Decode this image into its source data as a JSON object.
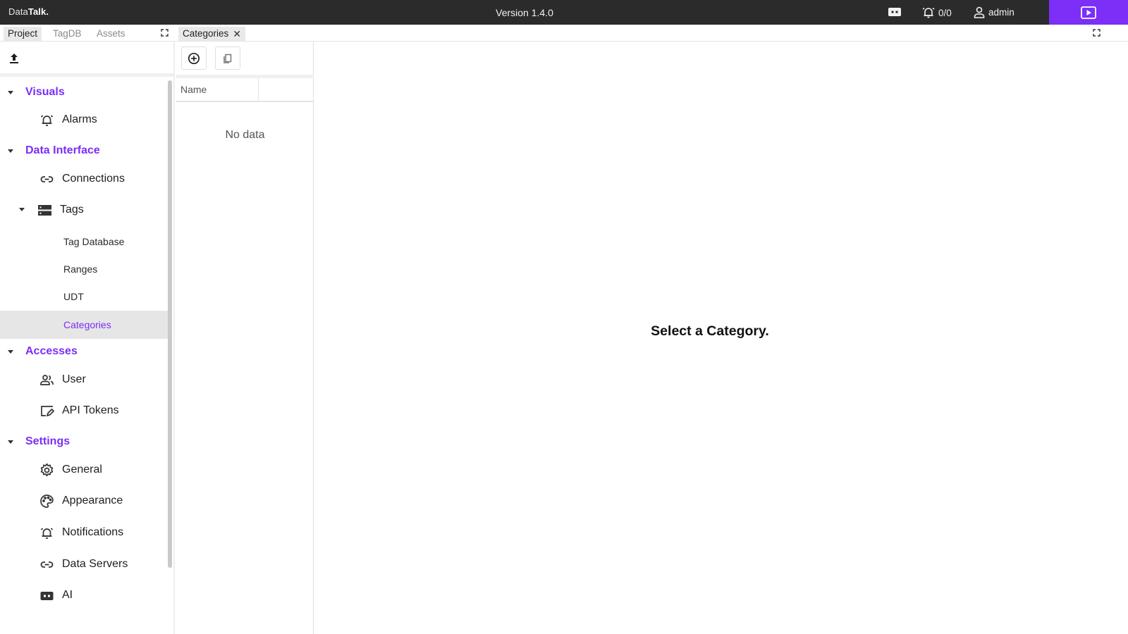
{
  "app": {
    "logo_prefix": "Data",
    "logo_bold": "Talk.",
    "version": "Version 1.4.0",
    "alarm_count": "0/0",
    "user": "admin",
    "accent": "#7b2ff7"
  },
  "left_tabs": [
    "Project",
    "TagDB",
    "Assets"
  ],
  "tree": {
    "visuals": {
      "title": "Visuals",
      "items": {
        "alarms": "Alarms"
      }
    },
    "data_interface": {
      "title": "Data Interface",
      "items": {
        "connections": "Connections",
        "tags": "Tags"
      },
      "tags_children": {
        "tag_database": "Tag Database",
        "ranges": "Ranges",
        "udt": "UDT",
        "categories": "Categories"
      }
    },
    "accesses": {
      "title": "Accesses",
      "items": {
        "user": "User",
        "api_tokens": "API Tokens"
      }
    },
    "settings": {
      "title": "Settings",
      "items": {
        "general": "General",
        "appearance": "Appearance",
        "notifications": "Notifications",
        "data_servers": "Data Servers",
        "ai": "AI"
      }
    }
  },
  "doc_tab": {
    "label": "Categories",
    "close": "✕"
  },
  "grid": {
    "col_name": "Name",
    "empty": "No data"
  },
  "main": {
    "empty_message": "Select a Category."
  }
}
